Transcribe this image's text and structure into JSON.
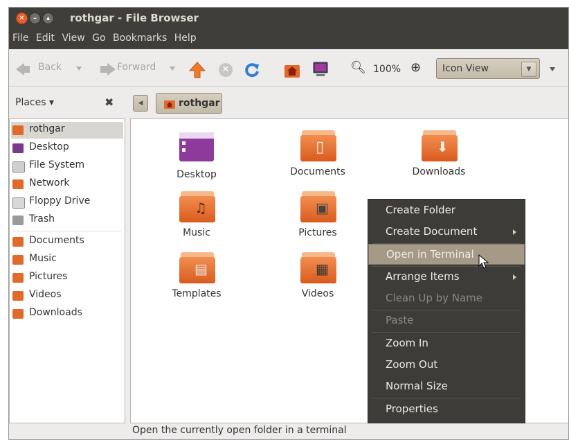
{
  "window": {
    "title": "rothgar - File Browser"
  },
  "menubar": [
    "File",
    "Edit",
    "View",
    "Go",
    "Bookmarks",
    "Help"
  ],
  "toolbar": {
    "back_label": "Back",
    "forward_label": "Forward",
    "zoom_level": "100%",
    "view_mode": "Icon View"
  },
  "places": {
    "label": "Places ▾"
  },
  "breadcrumb": {
    "current": "rothgar"
  },
  "sidebar": {
    "items": [
      "rothgar",
      "Desktop",
      "File System",
      "Network",
      "Floppy Drive",
      "Trash"
    ],
    "bookmarks": [
      "Documents",
      "Music",
      "Pictures",
      "Videos",
      "Downloads"
    ]
  },
  "files": [
    "Desktop",
    "Documents",
    "Downloads",
    "Music",
    "Pictures",
    "Templates",
    "Videos"
  ],
  "context_menu": {
    "items": [
      "Create Folder",
      "Create Document",
      "Open in Terminal",
      "Arrange Items",
      "Clean Up by Name",
      "Paste",
      "Zoom In",
      "Zoom Out",
      "Normal Size",
      "Properties"
    ]
  },
  "status": "Open the currently open folder in a terminal",
  "colors": {
    "titlebar": "#3f3e3a",
    "folder": "#e06a2a",
    "menu_bg": "#3e3c38",
    "menu_highlight": "#a49a87"
  }
}
